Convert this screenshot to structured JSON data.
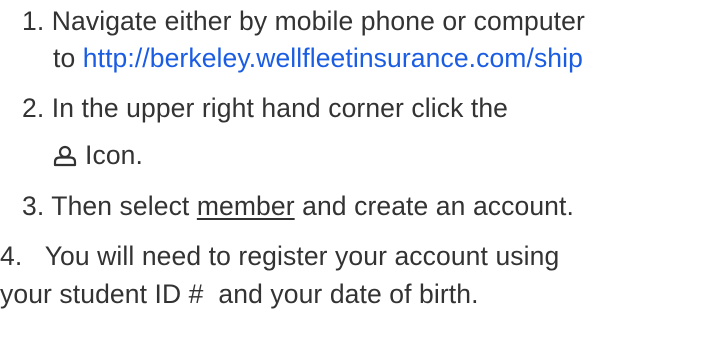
{
  "instructions": {
    "step1": {
      "number": "1.",
      "text_a": "Navigate either by mobile phone or computer",
      "text_b_prefix": "to ",
      "link": "http://berkeley.wellfleetinsurance.com/ship"
    },
    "step2": {
      "number": "2.",
      "text_a": "In the upper right hand corner click the",
      "icon": "user-icon",
      "icon_label": "Icon."
    },
    "step3": {
      "number": "3.",
      "prefix": "Then select ",
      "underlined": "member",
      "suffix": " and create an account."
    },
    "step4": {
      "number": "4.",
      "text_a": "You will need to register your account using",
      "text_b": "your student ID #  and your date of birth."
    }
  }
}
